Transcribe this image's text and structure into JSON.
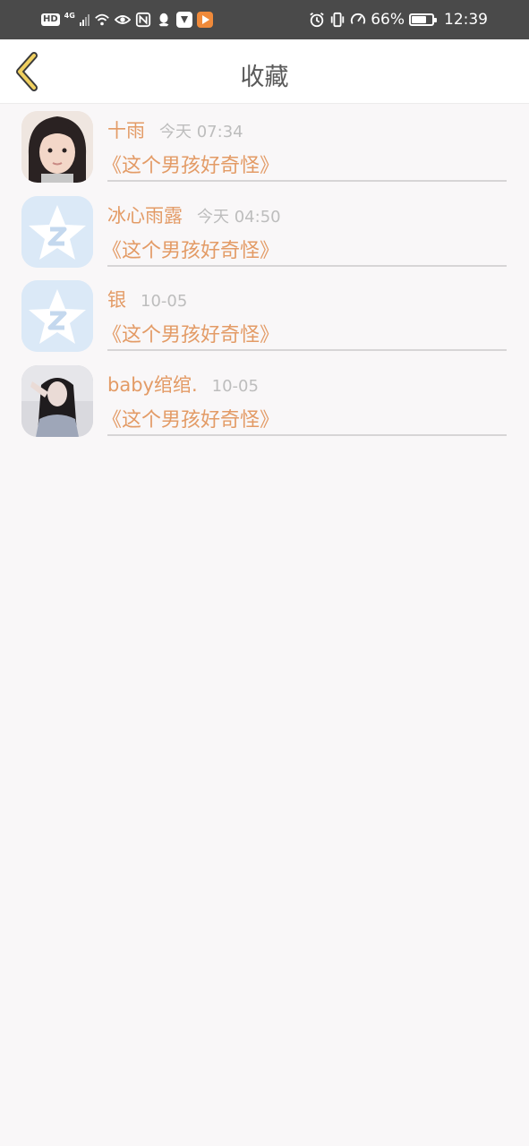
{
  "status_bar": {
    "hd_label": "HD",
    "network_label": "4G",
    "battery_percent": "66%",
    "battery_level": 0.66,
    "time": "12:39",
    "app_badges": [
      "qq-icon",
      "app-icon",
      "player-icon"
    ]
  },
  "header": {
    "title": "收藏"
  },
  "favorites": [
    {
      "username": "十雨",
      "timestamp": "今天 07:34",
      "book_title": "《这个男孩好奇怪》",
      "avatar": "girl-photo"
    },
    {
      "username": "冰心雨露",
      "timestamp": "今天 04:50",
      "book_title": "《这个男孩好奇怪》",
      "avatar": "qq-default-avatar"
    },
    {
      "username": "银",
      "timestamp": "10-05",
      "book_title": "《这个男孩好奇怪》",
      "avatar": "qq-default-avatar"
    },
    {
      "username": "baby绾绾.",
      "timestamp": "10-05",
      "book_title": "《这个男孩好奇怪》",
      "avatar": "girl-photo"
    }
  ],
  "colors": {
    "status_bar_bg": "#4a4a4a",
    "accent": "#e39b66",
    "timestamp": "#bdbdbd",
    "back_arrow": "#f0d060"
  }
}
